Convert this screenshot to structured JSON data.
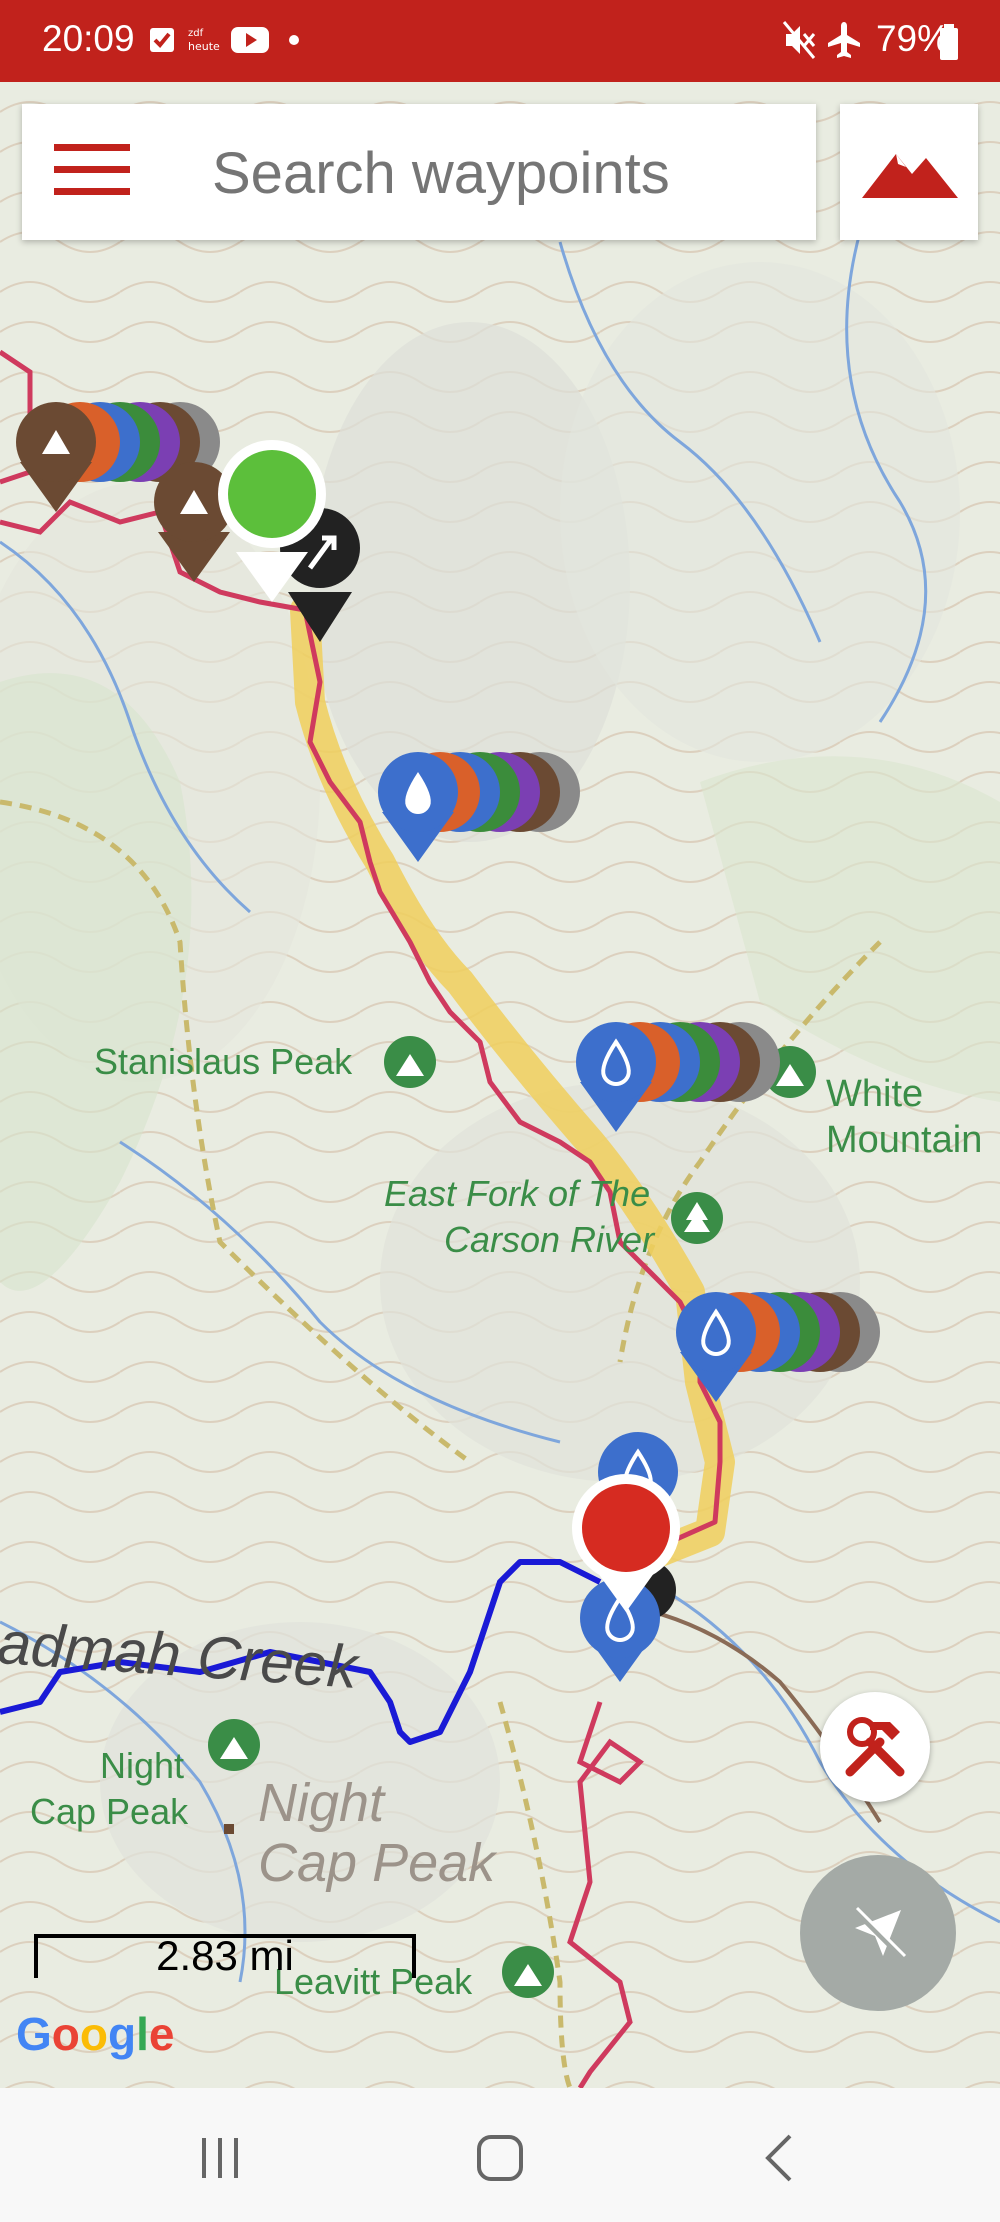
{
  "status_bar": {
    "time": "20:09",
    "battery": "79%",
    "icons": [
      "checkbox-icon",
      "zdf-heute-icon",
      "youtube-icon",
      "dot-icon",
      "mute-icon",
      "airplane-icon",
      "battery-icon"
    ]
  },
  "search": {
    "placeholder": "Search waypoints",
    "menu_icon": "hamburger-menu-icon",
    "map_type_icon": "mountain-icon"
  },
  "map": {
    "labels": {
      "stanislaus_peak": "Stanislaus Peak",
      "white_mountain_1": "White",
      "white_mountain_2": "Mountain",
      "east_fork_1": "East Fork of The",
      "east_fork_2": "Carson River",
      "night_cap_1": "Night",
      "night_cap_2": "Cap Peak",
      "night_cap_big_1": "Night",
      "night_cap_big_2": "Cap Peak",
      "leavitt_peak": "Leavitt Peak",
      "creek": "admah Creek"
    },
    "scale_text": "2.83 mi",
    "attribution": "Google",
    "colors": {
      "trail": "#cf3a5e",
      "highlight": "#f0cf5c",
      "alt_route": "#1a1ad6",
      "water_marker": "#3d6fcc",
      "camp_marker": "#6b4a33",
      "start_marker": "#5cbf3b",
      "end_marker": "#d62b21",
      "accent": "#c1221c"
    }
  },
  "fabs": {
    "tools_icon": "tools-icon",
    "location_icon": "location-off-icon"
  },
  "nav_bar": {
    "icons": [
      "recent-apps-icon",
      "home-icon",
      "back-icon"
    ]
  }
}
